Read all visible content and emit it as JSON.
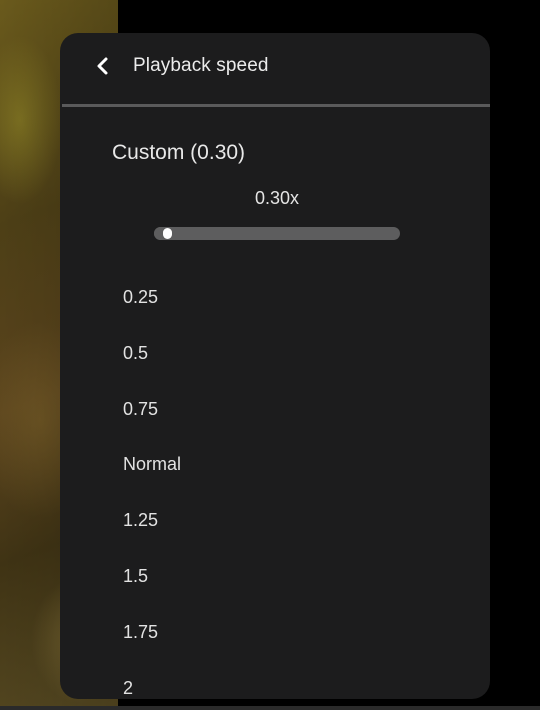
{
  "header": {
    "title": "Playback speed",
    "back_icon": "chevron-left-icon"
  },
  "custom": {
    "title": "Custom (0.30)",
    "readout": "0.30x",
    "slider": {
      "value": 0.3,
      "min": 0.25,
      "max": 2
    }
  },
  "speeds": [
    {
      "label": "0.25"
    },
    {
      "label": "0.5"
    },
    {
      "label": "0.75"
    },
    {
      "label": "Normal"
    },
    {
      "label": "1.25"
    },
    {
      "label": "1.5"
    },
    {
      "label": "1.75"
    },
    {
      "label": "2"
    }
  ],
  "colors": {
    "panel_bg": "#1c1c1d",
    "track": "#5d5d5e",
    "thumb": "#ffffff",
    "text": "#e6e6e6"
  }
}
